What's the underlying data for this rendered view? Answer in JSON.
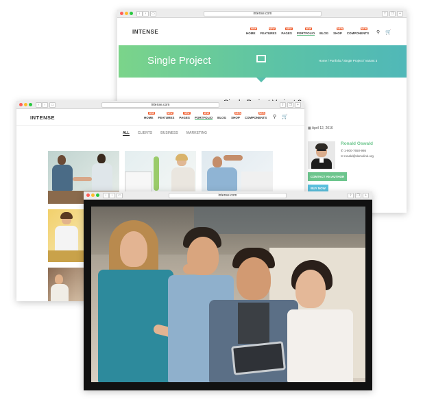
{
  "windows": {
    "top": {
      "url": "intense.com"
    },
    "mid": {
      "url": "intense.com"
    },
    "front": {
      "url": "intense.com"
    }
  },
  "site": {
    "logo": "INTENSE",
    "menu": [
      {
        "label": "HOME",
        "badge": "NEW"
      },
      {
        "label": "FEATURES",
        "badge": "NEW"
      },
      {
        "label": "PAGES",
        "badge": "NEW"
      },
      {
        "label": "PORTFOLIO",
        "badge": "NEW"
      },
      {
        "label": "BLOG",
        "badge": ""
      },
      {
        "label": "SHOP",
        "badge": "NEW"
      },
      {
        "label": "COMPONENTS",
        "badge": "NEW"
      }
    ]
  },
  "project_page": {
    "title": "Single Project",
    "breadcrumb": "Home / Portfolio / Single Project / Variant 3",
    "subtitle_partial": "Single Project Variant 3",
    "date": "April 12, 2016",
    "author": {
      "name": "Ronald Oswald",
      "phone": "1-800-7650-986",
      "email": "ronald@demolink.org"
    },
    "contact_button": "CONTACT AN AUTHOR",
    "buy_button": "BUY NOW"
  },
  "portfolio_page": {
    "filters": [
      "ALL",
      "CLIENTS",
      "BUSINESS",
      "MARKETING"
    ]
  },
  "colors": {
    "accent": "#6cc58d",
    "badge": "#ef5b2b",
    "buy": "#5bc0de"
  }
}
